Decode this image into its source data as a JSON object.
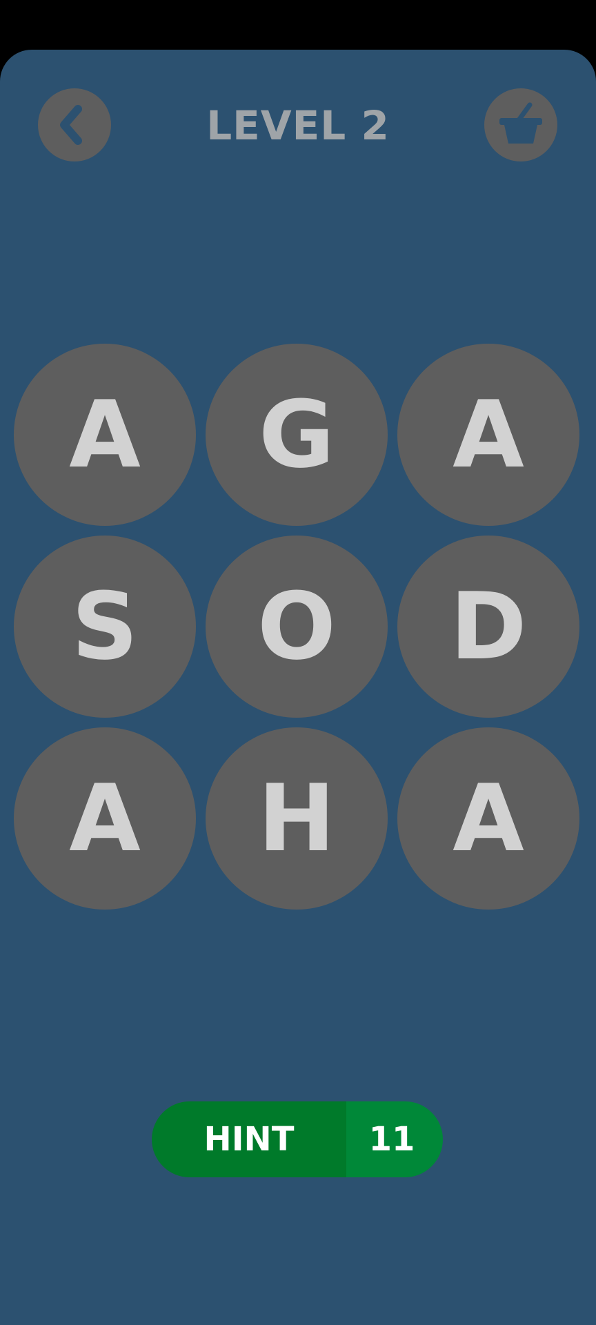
{
  "header": {
    "title": "LEVEL 2",
    "back_icon": "chevron-left-icon",
    "shop_icon": "basket-icon"
  },
  "grid": {
    "letters": [
      "A",
      "G",
      "A",
      "S",
      "O",
      "D",
      "A",
      "H",
      "A"
    ]
  },
  "hint": {
    "label": "HINT",
    "count": "11"
  },
  "colors": {
    "background": "#2c5170",
    "tile": "#5e5e5e",
    "letter": "#d2d2d2",
    "title": "#9fa4a8",
    "hint_label_bg": "#007a2a",
    "hint_count_bg": "#008838"
  }
}
